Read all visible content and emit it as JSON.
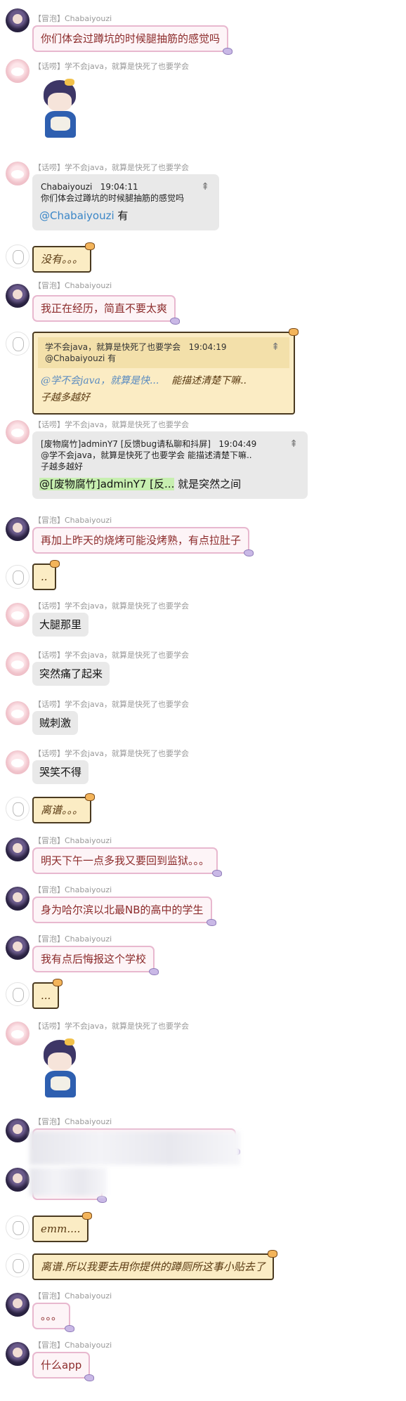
{
  "messages": [
    {
      "id": "m1",
      "avatar": "dark",
      "tag": "【冒泡】",
      "name": "Chabaiyouzi",
      "text": "你们体会过蹲坑的时候腿抽筋的感觉吗"
    },
    {
      "id": "m2",
      "avatar": "pink",
      "tag": "【话唠】",
      "name": "学不会java，就算是快死了也要学会",
      "sticker": "anime-girl-sticker"
    },
    {
      "id": "m3",
      "avatar": "pink",
      "tag": "【话唠】",
      "name": "学不会java，就算是快死了也要学会",
      "quote": {
        "author": "Chabaiyouzi",
        "time": "19:04:11",
        "text": "你们体会过蹲坑的时候腿抽筋的感觉吗"
      },
      "mention": "@Chabaiyouzi",
      "text": " 有"
    },
    {
      "id": "m4",
      "avatar": "sketch",
      "text": "没有。。。"
    },
    {
      "id": "m5",
      "avatar": "dark",
      "tag": "【冒泡】",
      "name": "Chabaiyouzi",
      "text": "我正在经历，简直不要太爽"
    },
    {
      "id": "m6",
      "avatar": "sketch",
      "quote": {
        "author": "学不会java，就算是快死了也要学会",
        "time": "19:04:19",
        "text": "@Chabaiyouzi 有"
      },
      "line1a": "@学不会java，就算是快...",
      "line1b": "能描述清楚下嘛..",
      "line2": "子越多越好"
    },
    {
      "id": "m7",
      "avatar": "pink",
      "tag": "【话唠】",
      "name": "学不会java，就算是快死了也要学会",
      "quote": {
        "author": "[废物腐竹]adminY7 [反馈bug请私聊和抖屏]",
        "time": "19:04:49",
        "text": "@学不会java，就算是快死了也要学会  能描述清楚下嘛..",
        "text2": "子越多越好"
      },
      "mention": "@[废物腐竹]adminY7 [反...",
      "text": " 就是突然之间"
    },
    {
      "id": "m8",
      "avatar": "dark",
      "tag": "【冒泡】",
      "name": "Chabaiyouzi",
      "text": "再加上昨天的烧烤可能没烤熟，有点拉肚子"
    },
    {
      "id": "m9",
      "avatar": "sketch",
      "text": ".."
    },
    {
      "id": "m10",
      "avatar": "pink",
      "tag": "【话唠】",
      "name": "学不会java，就算是快死了也要学会",
      "text": "大腿那里"
    },
    {
      "id": "m11",
      "avatar": "pink",
      "tag": "【话唠】",
      "name": "学不会java，就算是快死了也要学会",
      "text": "突然痛了起来"
    },
    {
      "id": "m12",
      "avatar": "pink",
      "tag": "【话唠】",
      "name": "学不会java，就算是快死了也要学会",
      "text": "贼刺激"
    },
    {
      "id": "m13",
      "avatar": "pink",
      "tag": "【话唠】",
      "name": "学不会java，就算是快死了也要学会",
      "text": "哭笑不得"
    },
    {
      "id": "m14",
      "avatar": "sketch",
      "text": "离谱。。。"
    },
    {
      "id": "m15",
      "avatar": "dark",
      "tag": "【冒泡】",
      "name": "Chabaiyouzi",
      "text": "明天下午一点多我又要回到监狱。。。"
    },
    {
      "id": "m16",
      "avatar": "dark",
      "tag": "【冒泡】",
      "name": "Chabaiyouzi",
      "text": "身为哈尔滨以北最NB的高中的学生"
    },
    {
      "id": "m17",
      "avatar": "dark",
      "tag": "【冒泡】",
      "name": "Chabaiyouzi",
      "text": "我有点后悔报这个学校"
    },
    {
      "id": "m18",
      "avatar": "sketch",
      "text": "..."
    },
    {
      "id": "m19",
      "avatar": "pink",
      "tag": "【话唠】",
      "name": "学不会java，就算是快死了也要学会",
      "sticker": "anime-girl-sticker"
    },
    {
      "id": "m20",
      "avatar": "dark",
      "tag": "【冒泡】",
      "name": "Chabaiyouzi",
      "text": ""
    },
    {
      "id": "m21",
      "avatar": "dark",
      "text": ""
    },
    {
      "id": "m22",
      "avatar": "sketch",
      "text": "emm...."
    },
    {
      "id": "m23",
      "avatar": "sketch",
      "text": "离谱.所以我要去用你提供的蹲厕所这事小贴去了"
    },
    {
      "id": "m24",
      "avatar": "dark",
      "tag": "【冒泡】",
      "name": "Chabaiyouzi",
      "text": "。。。"
    },
    {
      "id": "m25",
      "avatar": "dark",
      "tag": "【冒泡】",
      "name": "Chabaiyouzi",
      "text": "什么app"
    }
  ],
  "icons": {
    "pin": "pin-icon"
  },
  "colors": {
    "pink_border": "#e8b8cf",
    "pink_text": "#8c2b2b",
    "yellow_bg": "#fbecc4",
    "gray_bg": "#e9e9e9",
    "mention": "#3a86c7",
    "highlight": "#c7efb0"
  }
}
